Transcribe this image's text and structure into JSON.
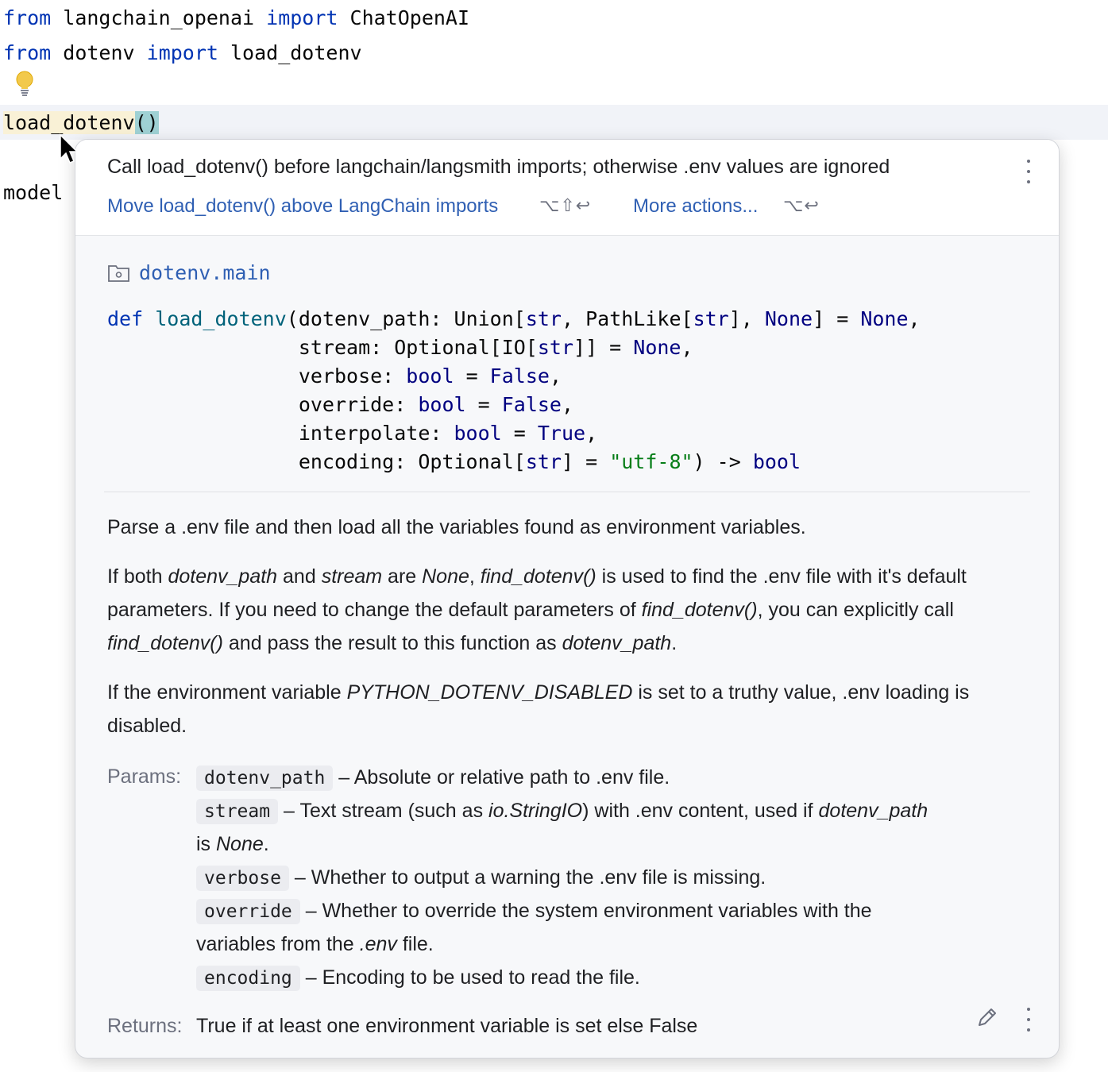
{
  "editor": {
    "line1": {
      "kw1": "from",
      "module": " langchain_openai ",
      "kw2": "import",
      "name": " ChatOpenAI"
    },
    "line2": {
      "kw1": "from",
      "module": " dotenv ",
      "kw2": "import",
      "name": " load_dotenv"
    },
    "line3": {
      "call": "load_dotenv",
      "parens": "()"
    },
    "line4": {
      "text": "model"
    }
  },
  "popup": {
    "problem_message": "Call load_dotenv() before langchain/langsmith imports; otherwise .env values are ignored",
    "quick_fix_label": "Move load_dotenv() above LangChain imports",
    "quick_fix_shortcut": "⌥⇧↩",
    "more_actions_label": "More actions...",
    "more_actions_shortcut": "⌥↩",
    "module": "dotenv.main",
    "signature": {
      "def": "def",
      "fn": "load_dotenv",
      "l1_a": "(dotenv_path: Union[",
      "l1_t1": "str",
      "l1_b": ", PathLike[",
      "l1_t2": "str",
      "l1_c": "], ",
      "l1_t3": "None",
      "l1_d": "] = ",
      "l1_t4": "None",
      "l1_e": ",",
      "l2_a": "stream: Optional[IO[",
      "l2_t1": "str",
      "l2_b": "]] = ",
      "l2_t2": "None",
      "l2_c": ",",
      "l3_a": "verbose: ",
      "l3_t1": "bool",
      "l3_b": " = ",
      "l3_t2": "False",
      "l3_c": ",",
      "l4_a": "override: ",
      "l4_t1": "bool",
      "l4_b": " = ",
      "l4_t2": "False",
      "l4_c": ",",
      "l5_a": "interpolate: ",
      "l5_t1": "bool",
      "l5_b": " = ",
      "l5_t2": "True",
      "l5_c": ",",
      "l6_a": "encoding: Optional[",
      "l6_t1": "str",
      "l6_b": "] = ",
      "l6_str": "\"utf-8\"",
      "l6_c": ") -> ",
      "l6_t2": "bool"
    },
    "description": "Parse a .env file and then load all the variables found as environment variables.",
    "para2": {
      "p1": "If both ",
      "i1": "dotenv_path",
      "p2": " and ",
      "i2": "stream",
      "p3": " are ",
      "i3": "None",
      "p4": ", ",
      "i4": "find_dotenv()",
      "p5": " is used to find the .env file with it's default parameters. If you need to change the default parameters of ",
      "i5": "find_dotenv()",
      "p6": ", you can explicitly call ",
      "i6": "find_dotenv()",
      "p7": " and pass the result to this function as ",
      "i7": "dotenv_path",
      "p8": "."
    },
    "para3": {
      "p1": "If the environment variable ",
      "i1": "PYTHON_DOTENV_DISABLED",
      "p2": " is set to a truthy value, .env loading is disabled."
    },
    "params_label": "Params:",
    "params": {
      "dotenv_path": {
        "name": "dotenv_path",
        "desc": " – Absolute or relative path to .env file."
      },
      "stream": {
        "name": "stream",
        "d1": " – Text stream (such as ",
        "i1": "io.StringIO",
        "d2": ") with .env content, used if ",
        "i2": "dotenv_path",
        "d3": "is ",
        "i3": "None",
        "d4": "."
      },
      "verbose": {
        "name": "verbose",
        "desc": " – Whether to output a warning the .env file is missing."
      },
      "override": {
        "name": "override",
        "d1": " – Whether to override the system environment variables with the",
        "d2": "variables from the ",
        "i1": ".env",
        "d3": " file."
      },
      "encoding": {
        "name": "encoding",
        "desc": " – Encoding to be used to read the file."
      }
    },
    "returns_label": "Returns:",
    "returns_text": "True if at least one environment variable is set else False"
  },
  "icons": {
    "bulb": "lightbulb-icon",
    "cursor": "mouse-pointer-icon",
    "module": "folder-module-icon",
    "menu": "more-vertical-icon",
    "edit": "pencil-icon"
  },
  "colors": {
    "keyword": "#0033b3",
    "link": "#2f5fb3",
    "warning_highlight": "#f9f1d6",
    "paren_highlight": "#9fd1d4",
    "popup_bg": "#f7f8fa"
  }
}
